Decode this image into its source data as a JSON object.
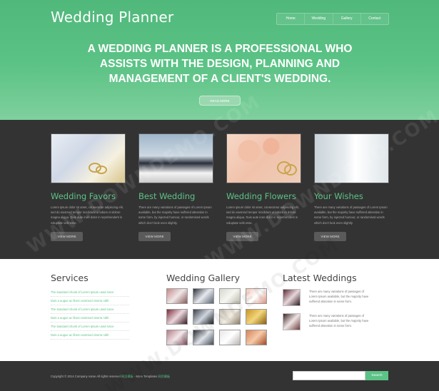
{
  "header": {
    "logo": "Wedding Planner",
    "nav": [
      "Home",
      "Wedding",
      "Gallery",
      "Contact"
    ],
    "headline": "A WEDDING PLANNER IS A PROFESSIONAL WHO ASSISTS WITH THE DESIGN, PLANNING AND MANAGEMENT OF A CLIENT'S WEDDING.",
    "read_more_label": "READ MORE"
  },
  "features": [
    {
      "title": "Wedding Favors",
      "desc": "Lorem ipsum dolor sit amet, consectetur adipiscing elit, sed do eiusmod tempor incididunt ut labore et dolore magna aliqua. Duis aute irure dolor in reprehenderit in voluptate velit esse.",
      "button": "VIEW MORE",
      "image": "wedding-favors-photo"
    },
    {
      "title": "Best Wedding",
      "desc": "There are many variations of passages of Lorem Ipsum available, but the majority have suffered alteration in some form, by injected humour, or randomised words which don't look even slightly.",
      "button": "VIEW MORE",
      "image": "best-wedding-photo"
    },
    {
      "title": "Wedding Flowers",
      "desc": "Lorem ipsum dolor sit amet, consectetur adipiscing elit, sed do eiusmod tempor incididunt ut labore et dolore magna aliqua. Duis aute irure dolor in reprehenderit in voluptate velit esse.",
      "button": "VIEW MORE",
      "image": "wedding-flowers-photo"
    },
    {
      "title": "Your Wishes",
      "desc": "There are many variations of passages of Lorem Ipsum available, but the majority have suffered alteration in some form, by injected humour, or randomised words which don't look even slightly.",
      "button": "VIEW MORE",
      "image": "your-wishes-photo"
    }
  ],
  "services": {
    "title": "Services",
    "items": [
      "The standard chunk of Lorem Ipsum used since",
      "Duis a augue ac libero euismod viverra nibh",
      "The standard chunk of Lorem Ipsum used since",
      "Duis a augue ac libero euismod viverra nibh",
      "The standard chunk of Lorem Ipsum used since",
      "Duis a augue ac libero euismod viverra nibh"
    ]
  },
  "gallery": {
    "title": "Wedding Gallery",
    "thumbs": [
      "gallery-1",
      "gallery-2",
      "gallery-3",
      "gallery-4",
      "gallery-5",
      "gallery-6",
      "gallery-7",
      "gallery-8",
      "gallery-9",
      "gallery-10",
      "gallery-11",
      "gallery-12"
    ]
  },
  "latest": {
    "title": "Latest Weddings",
    "items": [
      {
        "text": "There are many variations of passages of Lorem Ipsum available, but the majority have suffered alteration in some form."
      },
      {
        "text": "There are many variations of passages of Lorem Ipsum available, but the majority have suffered alteration in some form."
      }
    ]
  },
  "footer": {
    "copyright_prefix": "Copyright © 2014 Company name All rights reserved",
    "copyright_link1": "网页模板",
    "copyright_mid": "- More Templates",
    "copyright_link2": "网页模板",
    "search_placeholder": "",
    "search_button": "Search"
  },
  "watermark": "WWW.DOWNDEMO.COM",
  "colors": {
    "accent": "#5cc386",
    "dark_band": "#333333",
    "footer": "#333333"
  }
}
